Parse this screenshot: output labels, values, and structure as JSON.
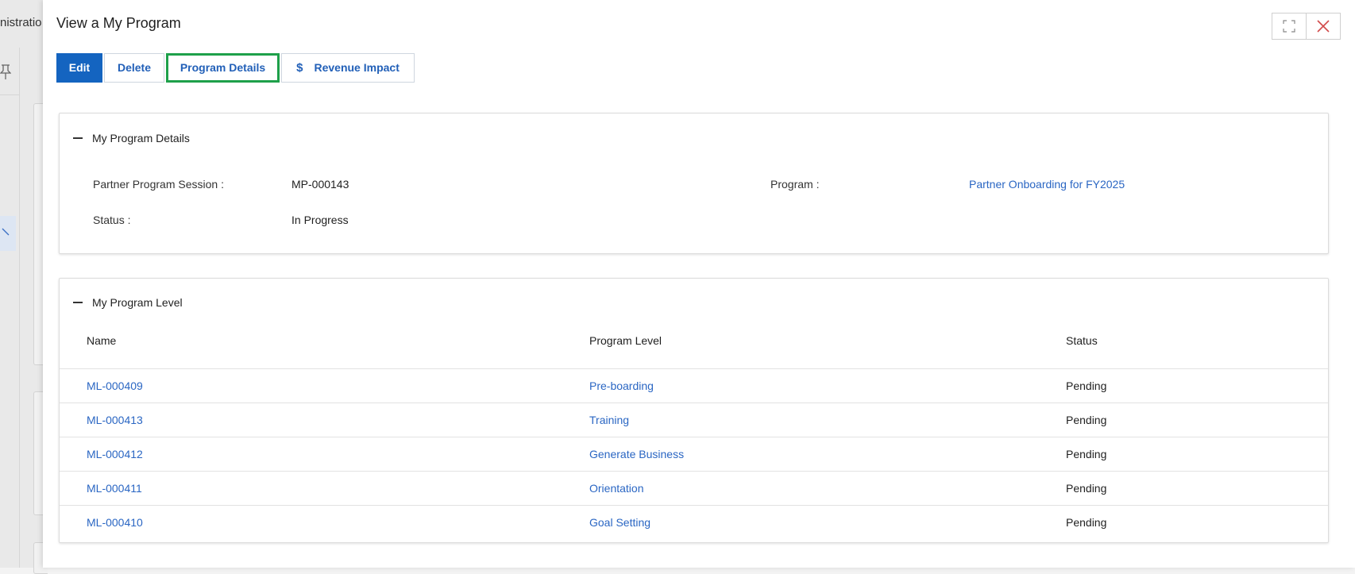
{
  "background": {
    "admin_text": "nistratio",
    "pin_icon": "pin-icon"
  },
  "modal": {
    "title": "View a My Program",
    "window_buttons": {
      "maximize_icon": "maximize-icon",
      "close_icon": "close-icon"
    },
    "toolbar": {
      "edit_label": "Edit",
      "delete_label": "Delete",
      "program_details_label": "Program Details",
      "revenue_impact_label": "Revenue Impact",
      "revenue_impact_icon": "dollar-icon"
    },
    "details_section": {
      "title": "My Program Details",
      "partner_program_session_label": "Partner Program Session :",
      "partner_program_session_value": "MP-000143",
      "program_label": "Program :",
      "program_value": "Partner Onboarding for FY2025",
      "status_label": "Status :",
      "status_value": "In Progress"
    },
    "level_section": {
      "title": "My Program Level",
      "columns": [
        "Name",
        "Program Level",
        "Status"
      ],
      "rows": [
        {
          "name": "ML-000409",
          "level": "Pre-boarding",
          "status": "Pending"
        },
        {
          "name": "ML-000413",
          "level": "Training",
          "status": "Pending"
        },
        {
          "name": "ML-000412",
          "level": "Generate Business",
          "status": "Pending"
        },
        {
          "name": "ML-000411",
          "level": "Orientation",
          "status": "Pending"
        },
        {
          "name": "ML-000410",
          "level": "Goal Setting",
          "status": "Pending"
        }
      ]
    }
  },
  "colors": {
    "primary": "#1464c0",
    "link": "#2a66c3",
    "highlight_border": "#1ea04a",
    "close_x": "#d24b4b"
  }
}
